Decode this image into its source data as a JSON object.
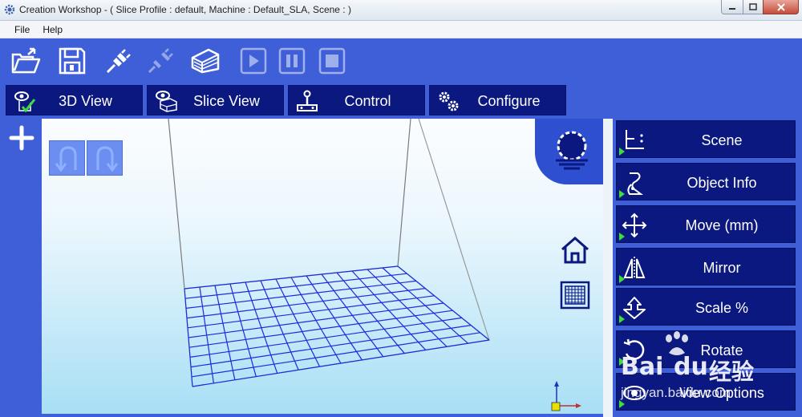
{
  "window": {
    "title": "Creation Workshop -   ( Slice Profile : default, Machine : Default_SLA, Scene : )"
  },
  "menu": {
    "items": [
      {
        "label": "File"
      },
      {
        "label": "Help"
      }
    ]
  },
  "toolbar": {
    "tools": [
      {
        "icon": "open-file-icon"
      },
      {
        "icon": "save-icon"
      },
      {
        "icon": "connect-icon"
      },
      {
        "icon": "disconnect-icon"
      },
      {
        "icon": "slice-icon"
      },
      {
        "icon": "play-icon"
      },
      {
        "icon": "pause-icon"
      },
      {
        "icon": "stop-icon"
      }
    ]
  },
  "tabs": [
    {
      "label": "3D View",
      "icon": "view-3d-icon"
    },
    {
      "label": "Slice View",
      "icon": "slice-view-icon"
    },
    {
      "label": "Control",
      "icon": "joystick-icon"
    },
    {
      "label": "Configure",
      "icon": "gears-icon"
    }
  ],
  "right_panel": {
    "buttons": [
      {
        "label": "Scene",
        "icon": "scene-axes-icon"
      },
      {
        "label": "Object Info",
        "icon": "object-info-icon"
      },
      {
        "label": "Move (mm)",
        "icon": "move-icon"
      },
      {
        "label": "Mirror",
        "icon": "mirror-icon"
      },
      {
        "label": "Scale %",
        "icon": "scale-icon"
      },
      {
        "label": "Rotate",
        "icon": "rotate-icon"
      },
      {
        "label": "View Options",
        "icon": "view-options-icon"
      }
    ]
  },
  "watermark": {
    "brand": "Bai",
    "brand2": "du",
    "cn": "经验",
    "url": "jingyan.baidu.com"
  },
  "colors": {
    "panel_blue": "#3f5fd8",
    "button_navy": "#0a1880",
    "grid_blue": "#1a2be0",
    "accent_green": "#3fdc3f"
  }
}
